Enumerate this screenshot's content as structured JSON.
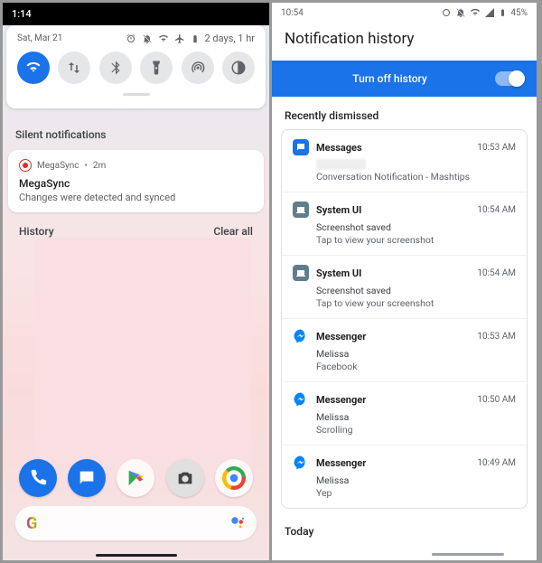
{
  "left": {
    "status_time": "1:14",
    "qs_date": "Sat, Mar 21",
    "qs_battery_detail": "2 days, 1 hr",
    "qs_tiles": {
      "wifi": "wifi-icon",
      "data": "mobile-data-icon",
      "bluetooth": "bluetooth-icon",
      "flashlight": "flashlight-icon",
      "hotspot": "hotspot-icon",
      "dark": "dark-theme-icon"
    },
    "silent_header": "Silent notifications",
    "notif": {
      "app": "MegaSync",
      "age": "2m",
      "title": "MegaSync",
      "body": "Changes were detected and synced"
    },
    "footer": {
      "history": "History",
      "clear": "Clear all"
    }
  },
  "right": {
    "status_time": "10:54",
    "battery_pct": "45%",
    "title": "Notification history",
    "toggle_label": "Turn off history",
    "section_recent": "Recently dismissed",
    "items": [
      {
        "icon": "messages",
        "app": "Messages",
        "time": "10:53 AM",
        "line1_hidden": true,
        "line2": "Conversation Notification - Mashtips"
      },
      {
        "icon": "system",
        "app": "System UI",
        "time": "10:54 AM",
        "line1": "Screenshot saved",
        "line2": "Tap to view your screenshot"
      },
      {
        "icon": "system",
        "app": "System UI",
        "time": "10:54 AM",
        "line1": "Screenshot saved",
        "line2": "Tap to view your screenshot"
      },
      {
        "icon": "msgr",
        "app": "Messenger",
        "time": "10:53 AM",
        "line1": "Melissa",
        "line2": "Facebook"
      },
      {
        "icon": "msgr",
        "app": "Messenger",
        "time": "10:50 AM",
        "line1": "Melissa",
        "line2": "Scrolling"
      },
      {
        "icon": "msgr",
        "app": "Messenger",
        "time": "10:49 AM",
        "line1": "Melissa",
        "line2": "Yep"
      }
    ],
    "section_today": "Today"
  }
}
